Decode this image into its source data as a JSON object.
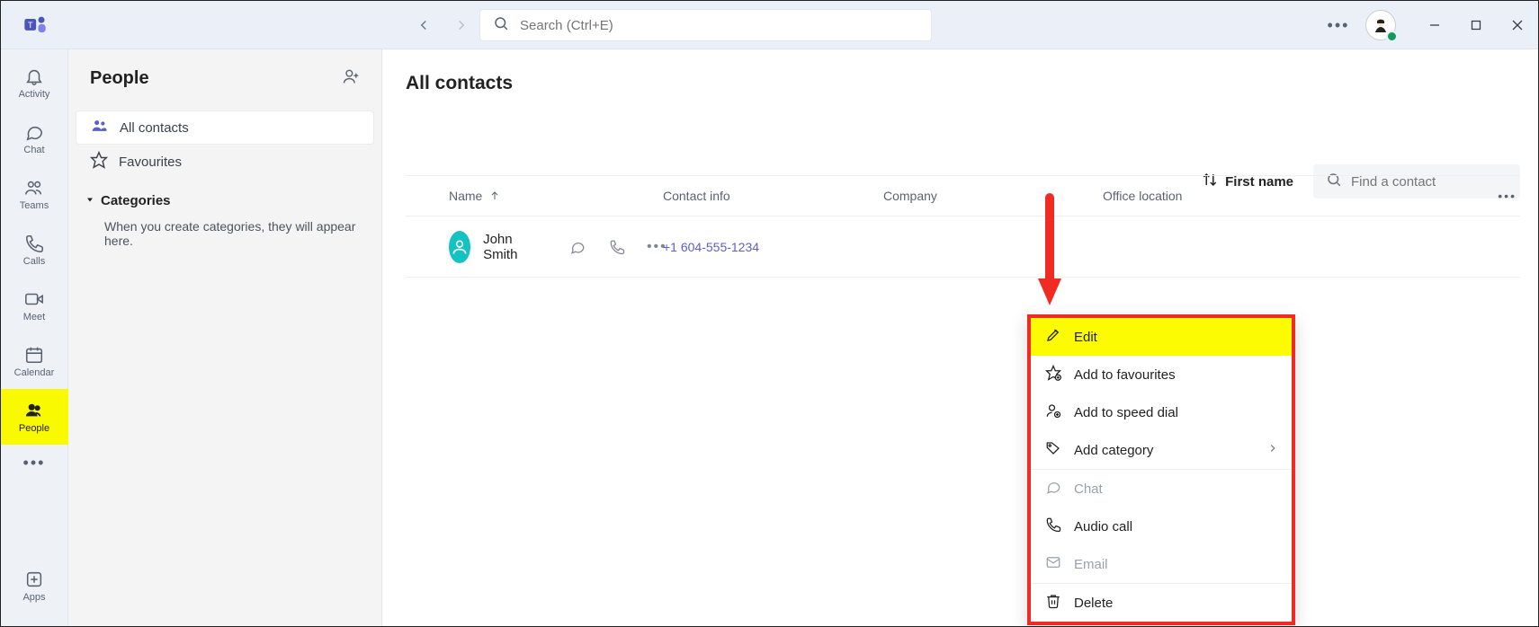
{
  "titlebar": {
    "search_placeholder": "Search (Ctrl+E)"
  },
  "rail": {
    "items": [
      {
        "label": "Activity"
      },
      {
        "label": "Chat"
      },
      {
        "label": "Teams"
      },
      {
        "label": "Calls"
      },
      {
        "label": "Meet"
      },
      {
        "label": "Calendar"
      },
      {
        "label": "People"
      },
      {
        "label": "Apps"
      }
    ]
  },
  "sidebar": {
    "title": "People",
    "items": [
      {
        "label": "All contacts"
      },
      {
        "label": "Favourites"
      }
    ],
    "categories_label": "Categories",
    "categories_help": "When you create categories, they will appear here."
  },
  "main": {
    "title": "All contacts",
    "sort_label": "First name",
    "find_placeholder": "Find a contact",
    "columns": {
      "name": "Name",
      "contact": "Contact info",
      "company": "Company",
      "office": "Office location"
    },
    "rows": [
      {
        "name": "John Smith",
        "phone": "+1 604-555-1234"
      }
    ]
  },
  "ctx": {
    "edit": "Edit",
    "fav": "Add to favourites",
    "speed": "Add to speed dial",
    "cat": "Add category",
    "chat": "Chat",
    "audio": "Audio call",
    "email": "Email",
    "delete": "Delete"
  }
}
